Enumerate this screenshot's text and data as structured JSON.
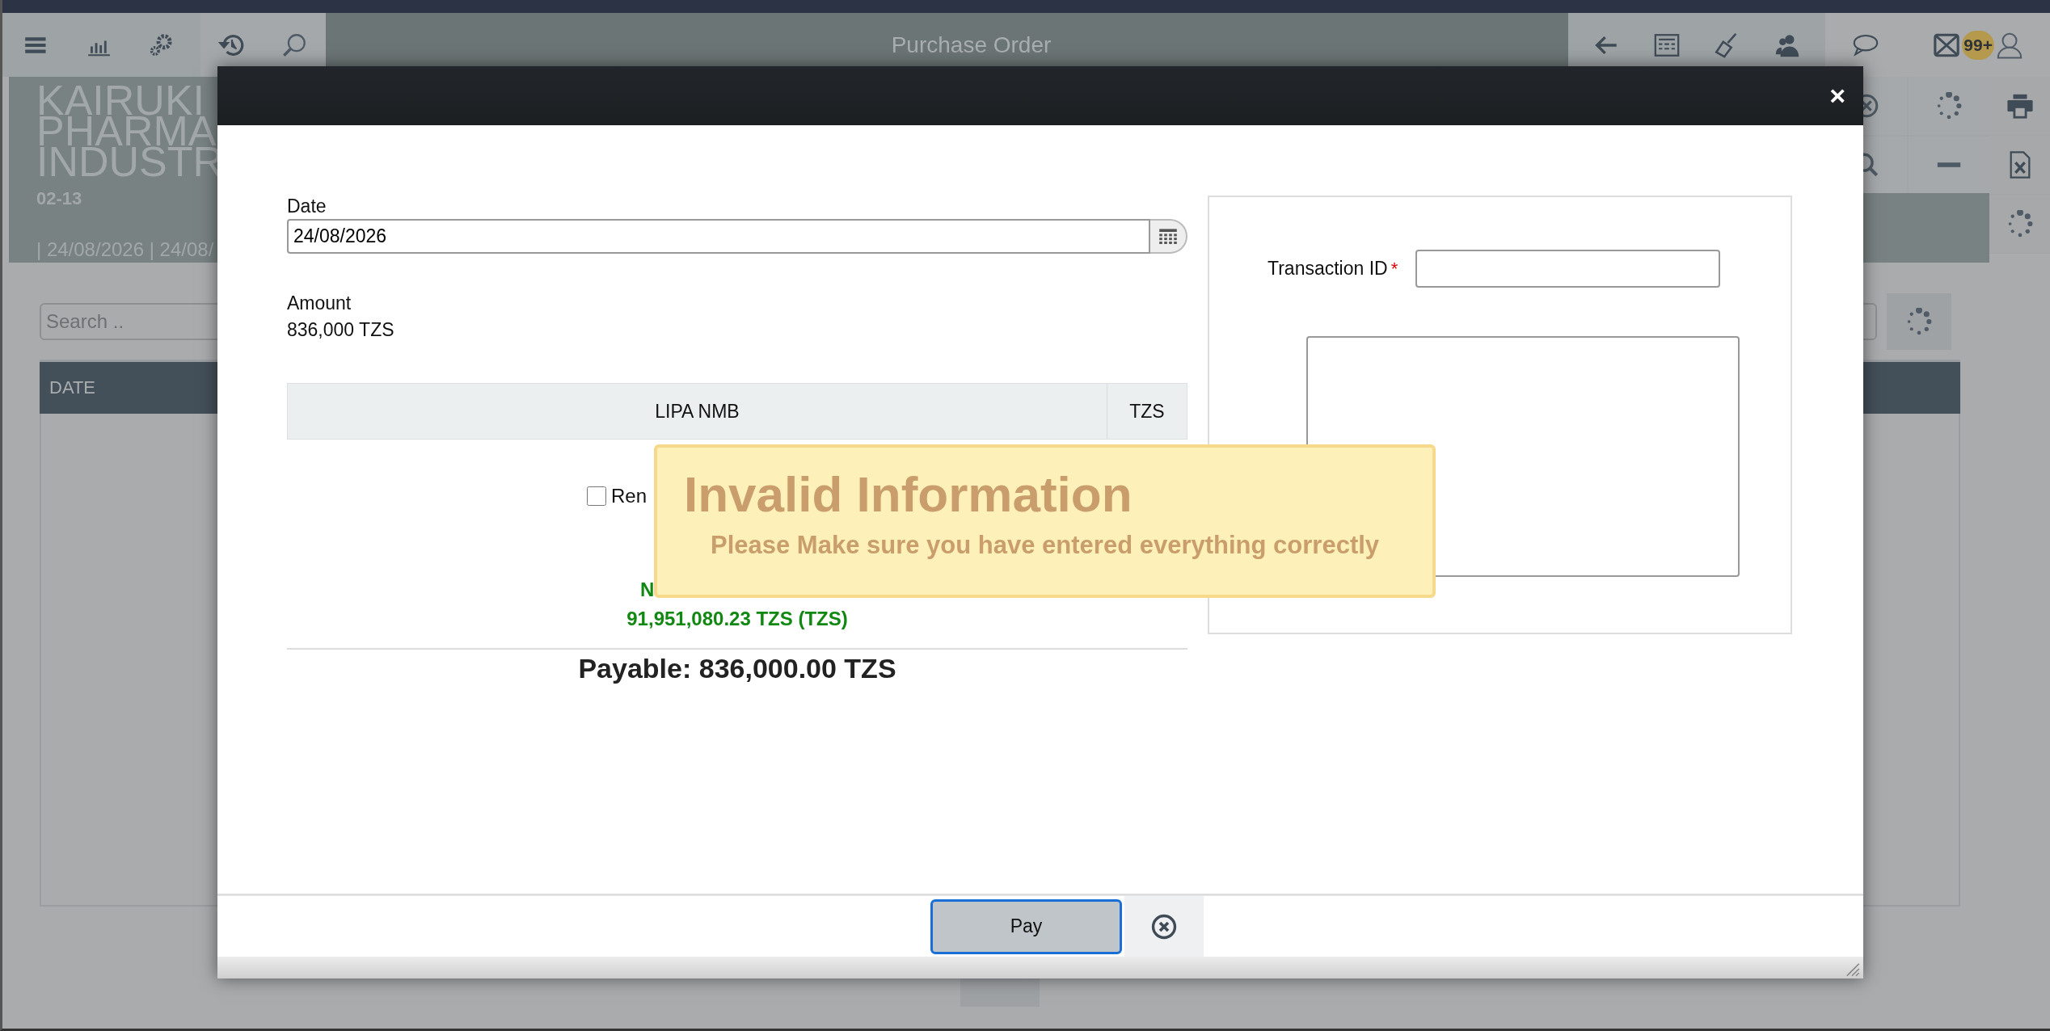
{
  "toolbar": {
    "title": "Purchase Order",
    "badge": "99+"
  },
  "header": {
    "company_lines": [
      "KAIRUKI",
      "PHARMA",
      "INDUSTR"
    ],
    "code": "02-13",
    "dates": "| 24/08/2026 | 24/08/"
  },
  "search": {
    "placeholder": "Search .."
  },
  "table": {
    "columns": [
      "DATE"
    ]
  },
  "dialog": {
    "close": "×",
    "date": {
      "label": "Date",
      "value": "24/08/2026"
    },
    "amount": {
      "label": "Amount",
      "value": "836,000 TZS"
    },
    "payment_row": [
      "LIPA NMB",
      "TZS"
    ],
    "options": [
      {
        "label": "Ren",
        "checked": false
      }
    ],
    "balance": {
      "label": "N",
      "value": "91,951,080.23 TZS (TZS)"
    },
    "payable": "Payable: 836,000.00 TZS",
    "transaction_id": {
      "label": "Transaction ID",
      "required_mark": "*"
    },
    "pay_button": "Pay"
  },
  "toast": {
    "title": "Invalid Information",
    "message": "Please Make sure you have entered everything correctly"
  }
}
